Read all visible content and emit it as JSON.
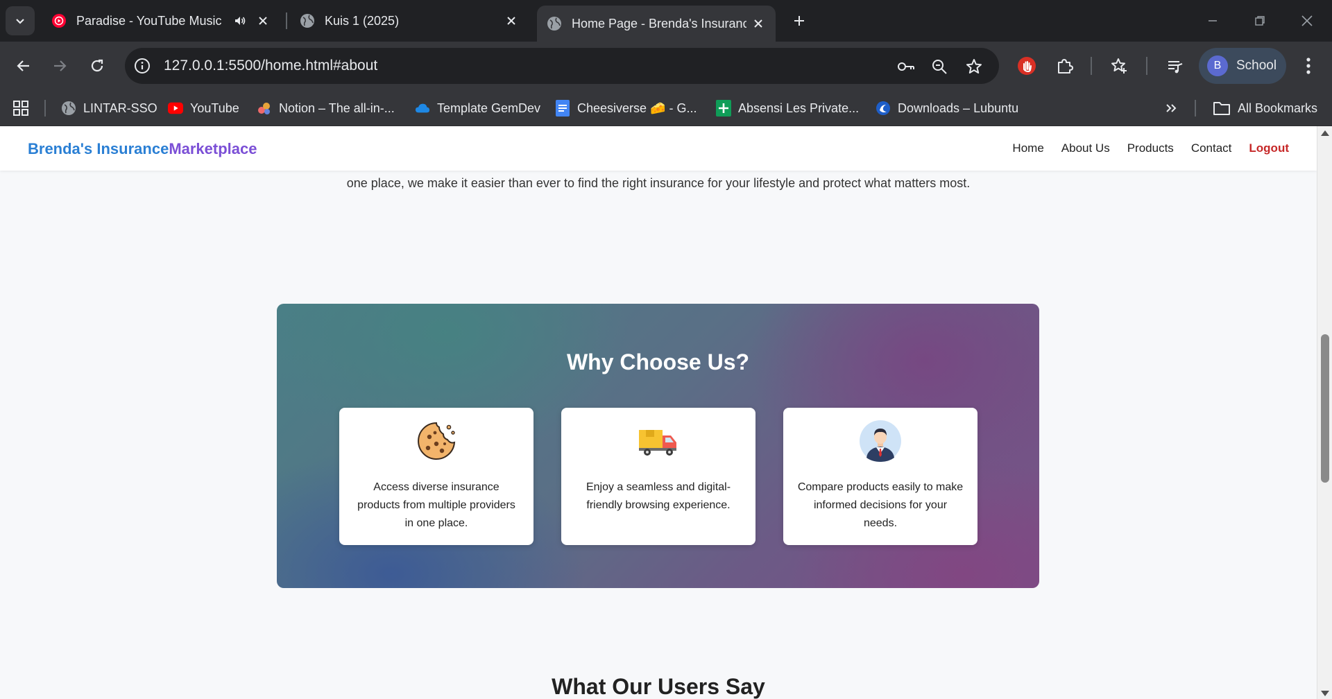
{
  "browser": {
    "tabs": [
      {
        "title": "Paradise - YouTube Music",
        "icon": "youtube-music-icon",
        "audio": true
      },
      {
        "title": "Kuis 1 (2025)",
        "icon": "globe-icon"
      },
      {
        "title": "Home Page - Brenda's Insuranc",
        "icon": "globe-icon",
        "active": true
      }
    ],
    "url": "127.0.0.1:5500/home.html#about",
    "profile": {
      "initial": "B",
      "name": "School"
    },
    "bookmarks": [
      {
        "label": "LINTAR-SSO",
        "icon": "globe-icon"
      },
      {
        "label": "YouTube",
        "icon": "youtube-icon"
      },
      {
        "label": "Notion – The all-in-...",
        "icon": "notion-icon"
      },
      {
        "label": "Template GemDev",
        "icon": "cloud-icon"
      },
      {
        "label": "Cheesiverse 🧀 - G...",
        "icon": "docs-icon"
      },
      {
        "label": "Absensi Les Private...",
        "icon": "sheets-icon"
      },
      {
        "label": "Downloads – Lubuntu",
        "icon": "lubuntu-icon"
      }
    ],
    "all_bookmarks": "All Bookmarks"
  },
  "site": {
    "brand": {
      "part1": "Brenda's Insurance",
      "part2": "Marketplace"
    },
    "nav": {
      "home": "Home",
      "about": "About Us",
      "products": "Products",
      "contact": "Contact",
      "logout": "Logout"
    },
    "about_tail": "one place, we make it easier than ever to find the right insurance for your lifestyle and protect what matters most.",
    "why": {
      "title": "Why Choose Us?",
      "cards": [
        {
          "icon": "cookie-icon",
          "text": "Access diverse insurance products from multiple providers in one place."
        },
        {
          "icon": "delivery-truck-icon",
          "text": "Enjoy a seamless and digital-friendly browsing experience."
        },
        {
          "icon": "businessman-avatar-icon",
          "text": "Compare products easily to make informed decisions for your needs."
        }
      ]
    },
    "users_title": "What Our Users Say"
  }
}
